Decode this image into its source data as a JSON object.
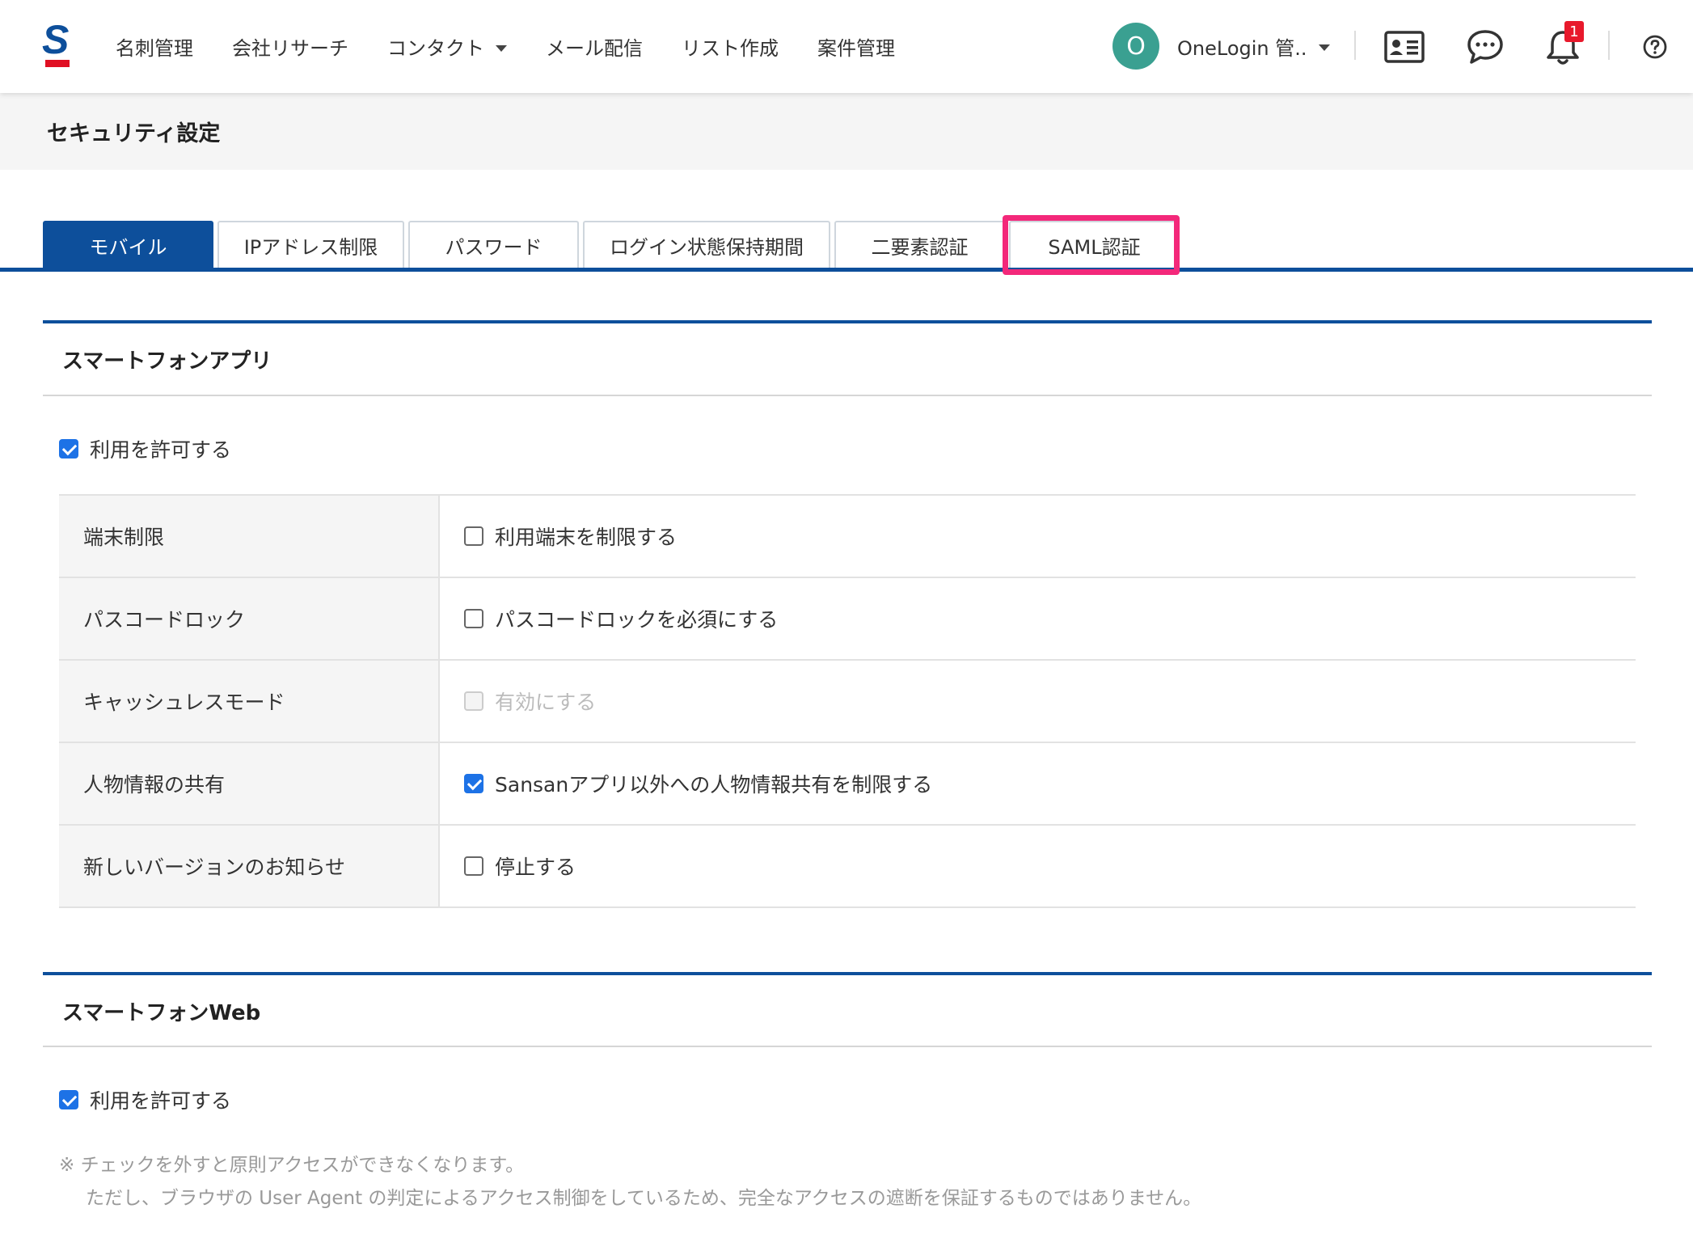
{
  "header": {
    "logo_letter": "S",
    "nav": [
      {
        "label": "名刺管理",
        "dropdown": false
      },
      {
        "label": "会社リサーチ",
        "dropdown": false
      },
      {
        "label": "コンタクト",
        "dropdown": true
      },
      {
        "label": "メール配信",
        "dropdown": false
      },
      {
        "label": "リスト作成",
        "dropdown": false
      },
      {
        "label": "案件管理",
        "dropdown": false
      }
    ],
    "user": {
      "initial": "O",
      "name": "OneLogin 管.."
    },
    "notification_count": "1",
    "icons": [
      "contact-card-icon",
      "chat-bubble-icon",
      "bell-icon",
      "help-icon"
    ]
  },
  "page": {
    "title": "セキュリティ設定"
  },
  "tabs": [
    {
      "label": "モバイル",
      "active": true
    },
    {
      "label": "IPアドレス制限",
      "active": false
    },
    {
      "label": "パスワード",
      "active": false
    },
    {
      "label": "ログイン状態保持期間",
      "active": false
    },
    {
      "label": "二要素認証",
      "active": false
    },
    {
      "label": "SAML認証",
      "active": false,
      "highlighted": true
    }
  ],
  "sections": {
    "smartphone_app": {
      "title": "スマートフォンアプリ",
      "allow": {
        "label": "利用を許可する",
        "checked": true
      },
      "rows": [
        {
          "label": "端末制限",
          "option": "利用端末を制限する",
          "checked": false,
          "disabled": false
        },
        {
          "label": "パスコードロック",
          "option": "パスコードロックを必須にする",
          "checked": false,
          "disabled": false
        },
        {
          "label": "キャッシュレスモード",
          "option": "有効にする",
          "checked": false,
          "disabled": true
        },
        {
          "label": "人物情報の共有",
          "option": "Sansanアプリ以外への人物情報共有を制限する",
          "checked": true,
          "disabled": false
        },
        {
          "label": "新しいバージョンのお知らせ",
          "option": "停止する",
          "checked": false,
          "disabled": false
        }
      ]
    },
    "smartphone_web": {
      "title": "スマートフォンWeb",
      "allow": {
        "label": "利用を許可する",
        "checked": true
      },
      "note_line1": "※ チェックを外すと原則アクセスができなくなります。",
      "note_line2": "ただし、ブラウザの User Agent の判定によるアクセス制御をしているため、完全なアクセスの遮断を保証するものではありません。"
    }
  },
  "colors": {
    "brand_blue": "#0d4f9b",
    "highlight_pink": "#f3287a",
    "checkbox_blue": "#1d72e6",
    "badge_red": "#e8192c",
    "avatar_teal": "#3aa091"
  }
}
